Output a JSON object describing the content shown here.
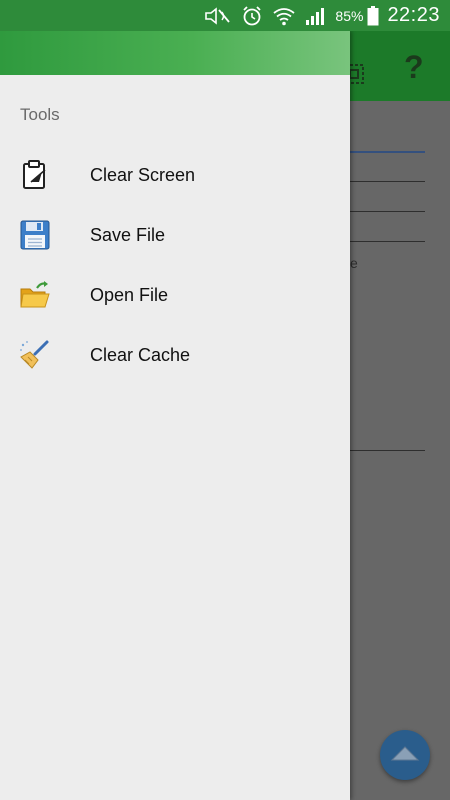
{
  "status_bar": {
    "battery_percent": "85%",
    "time": "22:23",
    "icons": [
      "mute-icon",
      "alarm-icon",
      "wifi-icon",
      "signal-icon",
      "battery-icon"
    ]
  },
  "toolbar": {
    "icons": [
      "grid-icon",
      "help-icon"
    ],
    "help_glyph": "?"
  },
  "background": {
    "partial_text": "e"
  },
  "drawer": {
    "section_title": "Tools",
    "items": [
      {
        "label": "Clear Screen",
        "icon": "clipboard-icon"
      },
      {
        "label": "Save File",
        "icon": "floppy-disk-icon"
      },
      {
        "label": "Open File",
        "icon": "folder-open-icon"
      },
      {
        "label": "Clear Cache",
        "icon": "broom-icon"
      }
    ]
  },
  "fab": {
    "icon": "chevron-up-icon"
  },
  "colors": {
    "status_bar": "#2e8b3a",
    "toolbar": "#1c7a29",
    "drawer_bg": "#ededed",
    "fab": "#2a5d8c"
  }
}
